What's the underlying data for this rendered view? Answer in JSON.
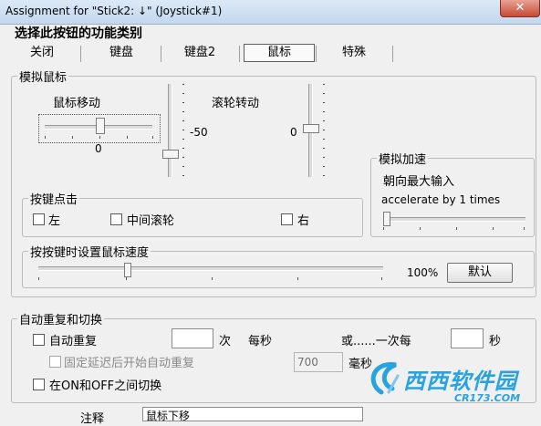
{
  "window": {
    "title": "Assignment for \"Stick2: ↓\" (Joystick#1)",
    "close_glyph": "✕"
  },
  "heading": "选择此按钮的功能类别",
  "tabs": [
    "关闭",
    "键盘",
    "键盘2",
    "鼠标",
    "特殊"
  ],
  "active_tab": "鼠标",
  "mouse_sim": {
    "legend": "模拟鼠标",
    "mouse_move": {
      "label": "鼠标移动",
      "value": "0"
    },
    "vertical_value": "-50",
    "wheel": {
      "label": "滚轮转动",
      "value": "0"
    }
  },
  "accel": {
    "legend": "模拟加速",
    "label": "朝向最大输入",
    "text": "accelerate by 1 times"
  },
  "click": {
    "legend": "按键点击",
    "left": "左",
    "middle": "中间滚轮",
    "right": "右"
  },
  "speed": {
    "legend": "按按键时设置鼠标速度",
    "value": "100%",
    "default_button": "默认"
  },
  "auto": {
    "legend": "自动重复和切换",
    "auto_repeat": "自动重复",
    "times_unit": "次",
    "per_second": "每秒",
    "or_once_per": "或......一次每",
    "seconds_unit": "秒",
    "delayed_start": "固定延迟后开始自动重复",
    "delay_value": "700",
    "ms_unit": "毫秒",
    "toggle": "在ON和OFF之间切换"
  },
  "note": {
    "label": "注释",
    "value": "鼠标下移"
  },
  "watermark": {
    "text": "西西软件园",
    "url_text": "CR173.COM"
  },
  "colors": {
    "accent": "#1e8fd6",
    "watermark": "#29a3e0"
  }
}
